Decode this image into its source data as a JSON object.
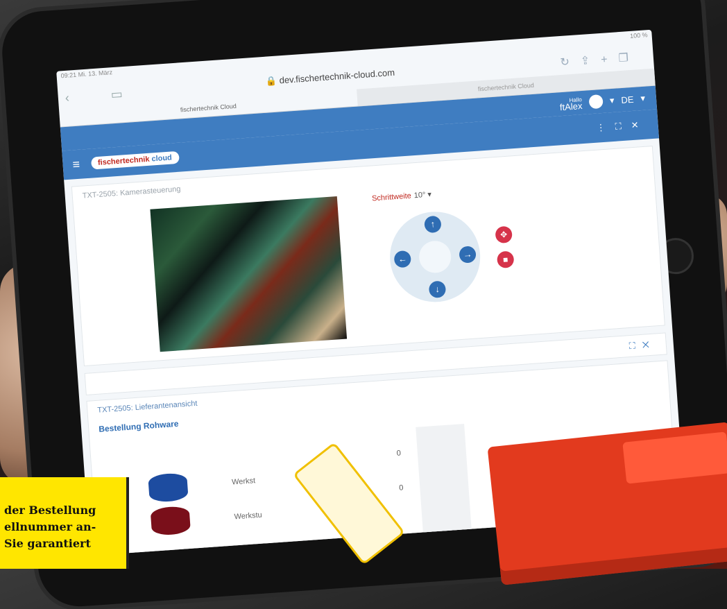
{
  "status": {
    "time": "09:21",
    "date": "Mi. 13. März",
    "battery": "100 %"
  },
  "browser": {
    "url": "dev.fischertechnik-cloud.com",
    "tab_active": "fischertechnik Cloud",
    "tab_inactive": "fischertechnik Cloud"
  },
  "user": {
    "greeting": "Hallo",
    "name": "ftAlex",
    "language": "DE"
  },
  "app": {
    "logo_text_1": "fischertechnik",
    "logo_text_2": "cloud"
  },
  "camera_panel": {
    "title": "TXT-2505: Kamerasteuerung",
    "step_label": "Schrittweite",
    "step_value": "10°"
  },
  "supplier_panel": {
    "title": "TXT-2505: Lieferantenansicht",
    "subtitle": "Bestellung Rohware",
    "items": [
      {
        "label": "Werkst",
        "count": "0"
      },
      {
        "label": "Werkstu",
        "count": "0"
      }
    ]
  },
  "caption": {
    "line1": "der Bestellung",
    "line2": "ellnummer an-",
    "line3": "Sie garantiert"
  }
}
